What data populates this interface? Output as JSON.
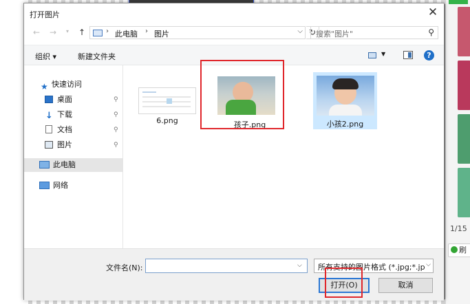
{
  "dialog": {
    "title": "打开图片",
    "close_glyph": "✕"
  },
  "navigation": {
    "back_glyph": "←",
    "forward_glyph": "→",
    "up_glyph": "↑",
    "path": [
      "此电脑",
      "图片"
    ],
    "refresh_glyph": "↻",
    "search_placeholder": "搜索\"图片\"",
    "search_icon": "search-icon"
  },
  "toolbar": {
    "organize": "组织 ▾",
    "new_folder": "新建文件夹",
    "help": "?"
  },
  "sidebar": {
    "items": [
      {
        "label": "快速访问",
        "icon": "star-icon"
      },
      {
        "label": "桌面",
        "icon": "desktop-icon",
        "pinned": true
      },
      {
        "label": "下载",
        "icon": "download-icon",
        "pinned": true
      },
      {
        "label": "文档",
        "icon": "document-icon",
        "pinned": true
      },
      {
        "label": "图片",
        "icon": "pictures-icon",
        "pinned": true
      },
      {
        "label": "此电脑",
        "icon": "computer-icon",
        "selected": true
      },
      {
        "label": "网络",
        "icon": "network-icon"
      }
    ],
    "pin_glyph": "📌"
  },
  "files": [
    {
      "name": "6.png"
    },
    {
      "name": "孩子.png"
    },
    {
      "name": "小孩2.png",
      "selected": true
    }
  ],
  "footer": {
    "filename_label": "文件名(N):",
    "filename_value": "",
    "filetype": "所有支持的图片格式 (*.jpg;*.jp",
    "open_button": "打开(O)",
    "cancel_button": "取消"
  },
  "background_app": {
    "pager": "1/15",
    "refresh_label": "刷"
  },
  "colors": {
    "accent": "#2a77d4",
    "highlight": "#e0262b",
    "selection": "#cce8ff"
  }
}
